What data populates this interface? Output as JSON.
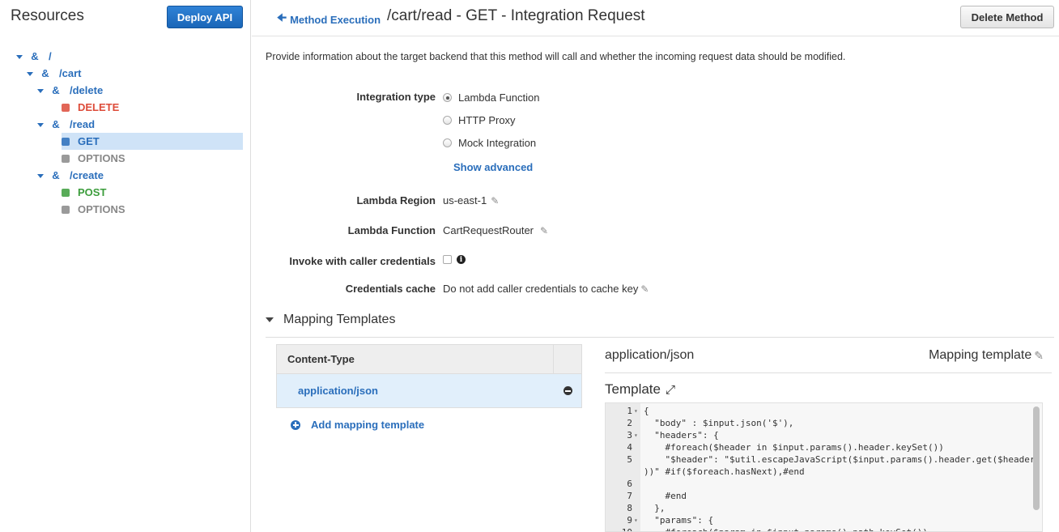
{
  "sidebar": {
    "title": "Resources",
    "deploy_label": "Deploy API",
    "tree": [
      {
        "kind": "resource",
        "label": "/",
        "level": 0
      },
      {
        "kind": "resource",
        "label": "/cart",
        "level": 1
      },
      {
        "kind": "resource",
        "label": "/delete",
        "level": 2
      },
      {
        "kind": "method",
        "label": "DELETE",
        "level": 3,
        "color": "#dd4b39"
      },
      {
        "kind": "resource",
        "label": "/read",
        "level": 2
      },
      {
        "kind": "method",
        "label": "GET",
        "level": 3,
        "color": "#2a6ebb",
        "selected": true
      },
      {
        "kind": "method",
        "label": "OPTIONS",
        "level": 3,
        "color": "#888888"
      },
      {
        "kind": "resource",
        "label": "/create",
        "level": 2
      },
      {
        "kind": "method",
        "label": "POST",
        "level": 3,
        "color": "#3c9d3c"
      },
      {
        "kind": "method",
        "label": "OPTIONS",
        "level": 3,
        "color": "#888888"
      }
    ]
  },
  "header": {
    "back_label": "Method Execution",
    "title": "/cart/read - GET - Integration Request",
    "delete_label": "Delete Method"
  },
  "description": "Provide information about the target backend that this method will call and whether the incoming request data should be modified.",
  "form": {
    "integration_type_label": "Integration type",
    "integration_options": [
      {
        "label": "Lambda Function",
        "selected": true
      },
      {
        "label": "HTTP Proxy",
        "selected": false
      },
      {
        "label": "Mock Integration",
        "selected": false
      }
    ],
    "show_advanced": "Show advanced",
    "lambda_region_label": "Lambda Region",
    "lambda_region_value": "us-east-1",
    "lambda_function_label": "Lambda Function",
    "lambda_function_value": "CartRequestRouter",
    "invoke_label": "Invoke with caller credentials",
    "credentials_cache_label": "Credentials cache",
    "credentials_cache_value": "Do not add caller credentials to cache key"
  },
  "mapping": {
    "section_title": "Mapping Templates",
    "column_header": "Content-Type",
    "content_type": "application/json",
    "add_label": "Add mapping template",
    "selected_content_type": "application/json",
    "mapping_template_label": "Mapping template",
    "template_title": "Template"
  },
  "editor": {
    "lines": [
      {
        "n": "1",
        "fold": true,
        "text": "{"
      },
      {
        "n": "2",
        "fold": false,
        "text": "  \"body\" : $input.json('$'),"
      },
      {
        "n": "3",
        "fold": true,
        "text": "  \"headers\": {"
      },
      {
        "n": "4",
        "fold": false,
        "text": "    #foreach($header in $input.params().header.keySet())"
      },
      {
        "n": "5",
        "fold": false,
        "text": "    \"$header\": \"$util.escapeJavaScript($input.params().header.get($header"
      },
      {
        "n": "",
        "fold": false,
        "text": "))\" #if($foreach.hasNext),#end"
      },
      {
        "n": "6",
        "fold": false,
        "text": ""
      },
      {
        "n": "7",
        "fold": false,
        "text": "    #end"
      },
      {
        "n": "8",
        "fold": false,
        "text": "  },"
      },
      {
        "n": "9",
        "fold": true,
        "text": "  \"params\": {"
      },
      {
        "n": "10",
        "fold": false,
        "text": "    #foreach($param in $input.params().path.keySet())"
      }
    ]
  }
}
